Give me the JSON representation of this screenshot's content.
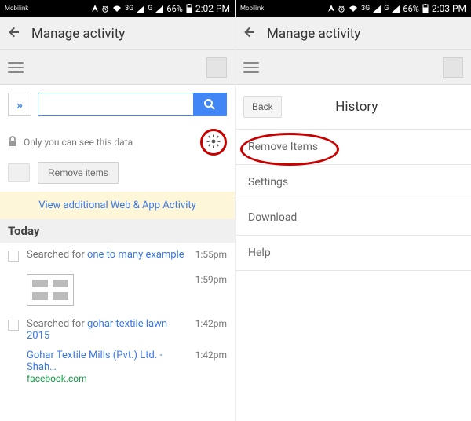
{
  "left": {
    "status": {
      "carrier": "Mobilink",
      "net": "3G",
      "sec": "G",
      "battery": "66%",
      "time": "2:02 PM"
    },
    "appbar_title": "Manage activity",
    "chev_glyph": "»",
    "search_placeholder": "",
    "privacy_text": "Only you can see this data",
    "remove_items_label": "Remove items",
    "banner_text": "View additional Web & App Activity",
    "today_label": "Today",
    "items": [
      {
        "prefix": "Searched for ",
        "link": "one to many example",
        "time": "1:55pm"
      },
      {
        "thumb": true,
        "time": "1:59pm"
      },
      {
        "prefix": "Searched for ",
        "link": "gohar textile lawn 2015",
        "time": "1:42pm"
      },
      {
        "link_only": "Gohar Textile Mills (Pvt.) Ltd. - Shah…",
        "green": "facebook.com",
        "time": "1:42pm"
      }
    ]
  },
  "right": {
    "status": {
      "carrier": "Mobilink",
      "net": "3G",
      "sec": "G",
      "battery": "66%",
      "time": "2:03 PM"
    },
    "appbar_title": "Manage activity",
    "back_label": "Back",
    "history_title": "History",
    "menu": [
      {
        "label": "Remove Items",
        "highlight": true
      },
      {
        "label": "Settings"
      },
      {
        "label": "Download"
      },
      {
        "label": "Help"
      }
    ]
  }
}
